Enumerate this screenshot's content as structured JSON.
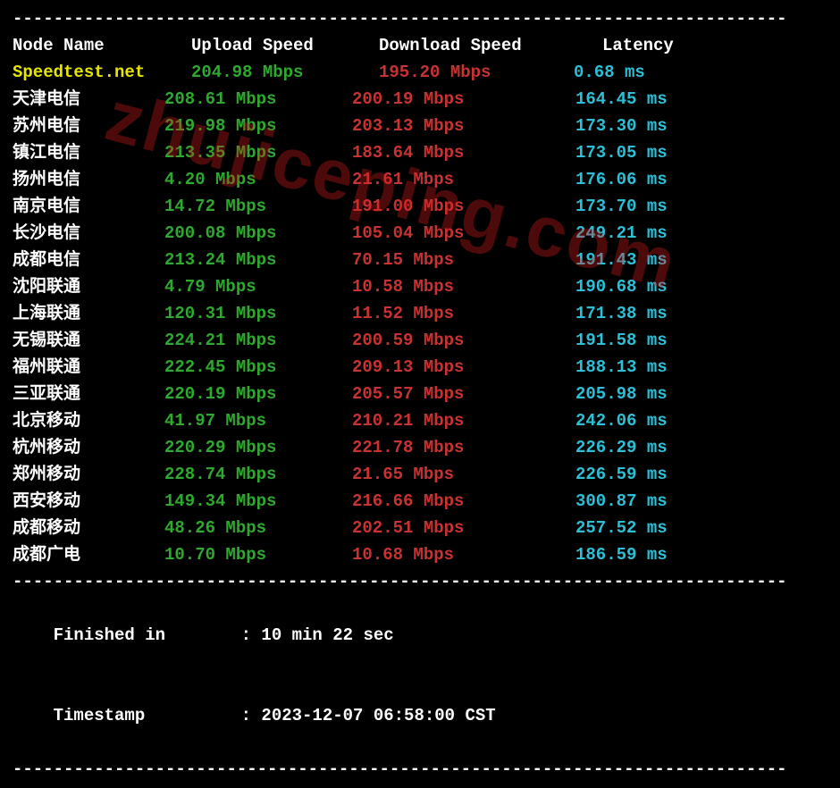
{
  "dashline": "----------------------------------------------------------------------------",
  "header": {
    "node": "Node Name",
    "upload": "Upload Speed",
    "download": "Download Speed",
    "latency": "Latency"
  },
  "speedtest": {
    "name": "Speedtest.net",
    "up": "204.98 Mbps",
    "dn": "195.20 Mbps",
    "lat": "0.68 ms"
  },
  "rows": [
    {
      "name": "天津电信",
      "up": "208.61 Mbps",
      "dn": "200.19 Mbps",
      "lat": "164.45 ms"
    },
    {
      "name": "苏州电信",
      "up": "219.98 Mbps",
      "dn": "203.13 Mbps",
      "lat": "173.30 ms"
    },
    {
      "name": "镇江电信",
      "up": "213.35 Mbps",
      "dn": "183.64 Mbps",
      "lat": "173.05 ms"
    },
    {
      "name": "扬州电信",
      "up": "4.20 Mbps",
      "dn": "21.61 Mbps",
      "lat": "176.06 ms"
    },
    {
      "name": "南京电信",
      "up": "14.72 Mbps",
      "dn": "191.00 Mbps",
      "lat": "173.70 ms"
    },
    {
      "name": "长沙电信",
      "up": "200.08 Mbps",
      "dn": "105.04 Mbps",
      "lat": "249.21 ms"
    },
    {
      "name": "成都电信",
      "up": "213.24 Mbps",
      "dn": "70.15 Mbps",
      "lat": "191.43 ms"
    },
    {
      "name": "沈阳联通",
      "up": "4.79 Mbps",
      "dn": "10.58 Mbps",
      "lat": "190.68 ms"
    },
    {
      "name": "上海联通",
      "up": "120.31 Mbps",
      "dn": "11.52 Mbps",
      "lat": "171.38 ms"
    },
    {
      "name": "无锡联通",
      "up": "224.21 Mbps",
      "dn": "200.59 Mbps",
      "lat": "191.58 ms"
    },
    {
      "name": "福州联通",
      "up": "222.45 Mbps",
      "dn": "209.13 Mbps",
      "lat": "188.13 ms"
    },
    {
      "name": "三亚联通",
      "up": "220.19 Mbps",
      "dn": "205.57 Mbps",
      "lat": "205.98 ms"
    },
    {
      "name": "北京移动",
      "up": "41.97 Mbps",
      "dn": "210.21 Mbps",
      "lat": "242.06 ms"
    },
    {
      "name": "杭州移动",
      "up": "220.29 Mbps",
      "dn": "221.78 Mbps",
      "lat": "226.29 ms"
    },
    {
      "name": "郑州移动",
      "up": "228.74 Mbps",
      "dn": "21.65 Mbps",
      "lat": "226.59 ms"
    },
    {
      "name": "西安移动",
      "up": "149.34 Mbps",
      "dn": "216.66 Mbps",
      "lat": "300.87 ms"
    },
    {
      "name": "成都移动",
      "up": "48.26 Mbps",
      "dn": "202.51 Mbps",
      "lat": "257.52 ms"
    },
    {
      "name": "成都广电",
      "up": "10.70 Mbps",
      "dn": "10.68 Mbps",
      "lat": "186.59 ms"
    }
  ],
  "footer": {
    "finished_label": "Finished in",
    "finished_value": "10 min 22 sec",
    "timestamp_label": "Timestamp",
    "timestamp_value": "2023-12-07 06:58:00 CST"
  },
  "watermark": "zhujiceping.com",
  "chart_data": {
    "type": "table",
    "title": "Speedtest results per node",
    "columns": [
      "Node Name",
      "Upload Speed (Mbps)",
      "Download Speed (Mbps)",
      "Latency (ms)"
    ],
    "rows": [
      [
        "Speedtest.net",
        204.98,
        195.2,
        0.68
      ],
      [
        "天津电信",
        208.61,
        200.19,
        164.45
      ],
      [
        "苏州电信",
        219.98,
        203.13,
        173.3
      ],
      [
        "镇江电信",
        213.35,
        183.64,
        173.05
      ],
      [
        "扬州电信",
        4.2,
        21.61,
        176.06
      ],
      [
        "南京电信",
        14.72,
        191.0,
        173.7
      ],
      [
        "长沙电信",
        200.08,
        105.04,
        249.21
      ],
      [
        "成都电信",
        213.24,
        70.15,
        191.43
      ],
      [
        "沈阳联通",
        4.79,
        10.58,
        190.68
      ],
      [
        "上海联通",
        120.31,
        11.52,
        171.38
      ],
      [
        "无锡联通",
        224.21,
        200.59,
        191.58
      ],
      [
        "福州联通",
        222.45,
        209.13,
        188.13
      ],
      [
        "三亚联通",
        220.19,
        205.57,
        205.98
      ],
      [
        "北京移动",
        41.97,
        210.21,
        242.06
      ],
      [
        "杭州移动",
        220.29,
        221.78,
        226.29
      ],
      [
        "郑州移动",
        228.74,
        21.65,
        226.59
      ],
      [
        "西安移动",
        149.34,
        216.66,
        300.87
      ],
      [
        "成都移动",
        48.26,
        202.51,
        257.52
      ],
      [
        "成都广电",
        10.7,
        10.68,
        186.59
      ]
    ]
  }
}
